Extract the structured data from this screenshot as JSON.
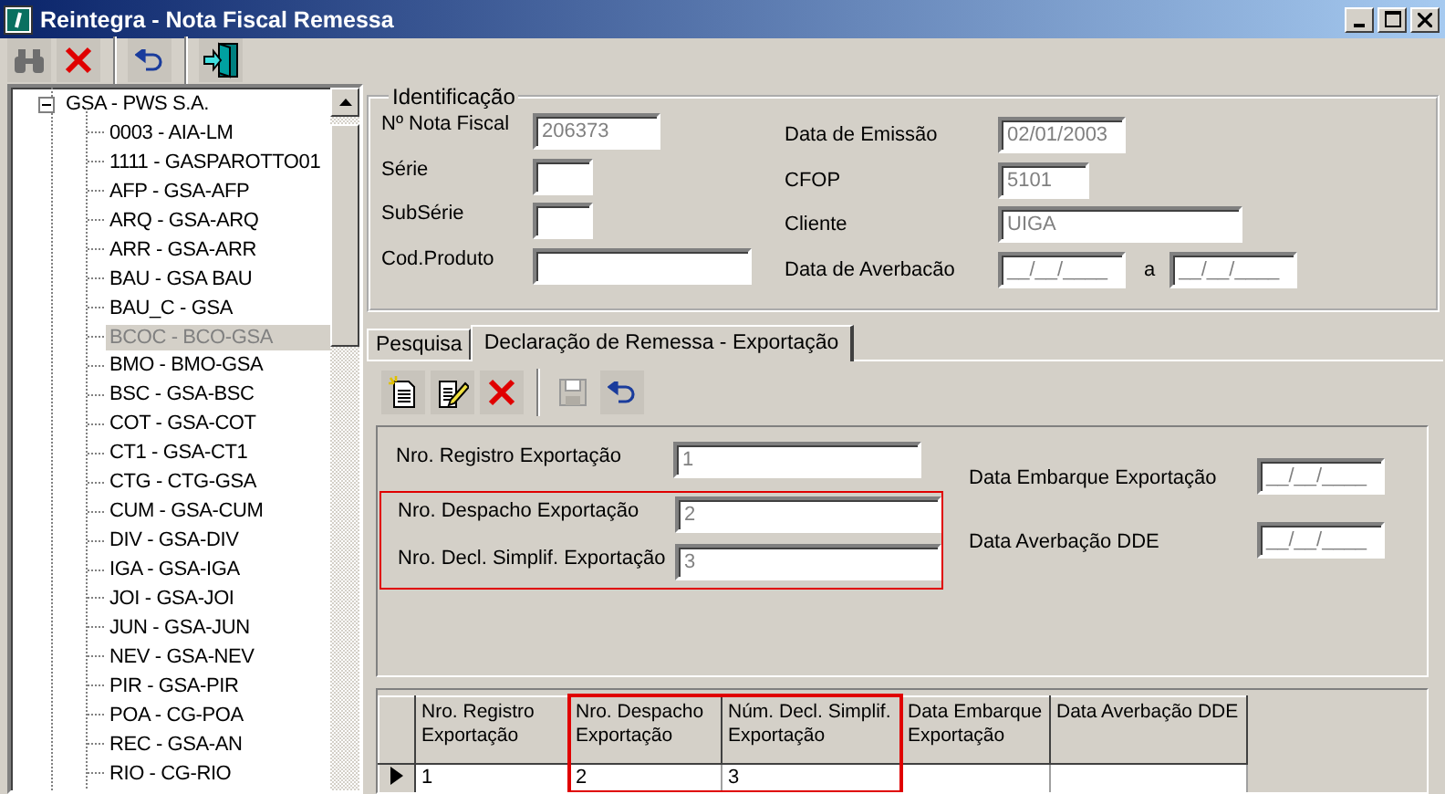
{
  "window": {
    "title": "Reintegra - Nota Fiscal Remessa"
  },
  "toolbar": [
    {
      "kind": "search",
      "disabled": false
    },
    {
      "kind": "delete",
      "disabled": false
    },
    {
      "kind": "undo",
      "disabled": false
    },
    {
      "kind": "exit",
      "disabled": false
    }
  ],
  "tree": {
    "label": "GSA - PWS S.A.",
    "expanded": true,
    "children": [
      {
        "label": "0003 - AIA-LM",
        "selected": false
      },
      {
        "label": "1111 - GASPAROTTO01",
        "selected": false
      },
      {
        "label": "AFP - GSA-AFP",
        "selected": false
      },
      {
        "label": "ARQ - GSA-ARQ",
        "selected": false
      },
      {
        "label": "ARR - GSA-ARR",
        "selected": false
      },
      {
        "label": "BAU - GSA BAU",
        "selected": false
      },
      {
        "label": "BAU_C - GSA",
        "selected": false
      },
      {
        "label": "BCOC - BCO-GSA",
        "selected": true
      },
      {
        "label": "BMO - BMO-GSA",
        "selected": false
      },
      {
        "label": "BSC - GSA-BSC",
        "selected": false
      },
      {
        "label": "COT - GSA-COT",
        "selected": false
      },
      {
        "label": "CT1 - GSA-CT1",
        "selected": false
      },
      {
        "label": "CTG - CTG-GSA",
        "selected": false
      },
      {
        "label": "CUM - GSA-CUM",
        "selected": false
      },
      {
        "label": "DIV - GSA-DIV",
        "selected": false
      },
      {
        "label": "IGA - GSA-IGA",
        "selected": false
      },
      {
        "label": "JOI - GSA-JOI",
        "selected": false
      },
      {
        "label": "JUN - GSA-JUN",
        "selected": false
      },
      {
        "label": "NEV - GSA-NEV",
        "selected": false
      },
      {
        "label": "PIR - GSA-PIR",
        "selected": false
      },
      {
        "label": "POA - CG-POA",
        "selected": false
      },
      {
        "label": "REC - GSA-AN",
        "selected": false
      },
      {
        "label": "RIO - CG-RIO",
        "selected": false
      }
    ]
  },
  "identificacao": {
    "title": "Identificação",
    "left_fields": [
      {
        "label": "Nº Nota Fiscal",
        "kind": "number",
        "value": "206373"
      },
      {
        "label": "Série",
        "kind": "short"
      },
      {
        "label": "SubSérie",
        "kind": "short"
      },
      {
        "label": "Cod.Produto",
        "kind": "long"
      }
    ],
    "right_fields": [
      {
        "label": "Data de Emissão",
        "kind": "date",
        "value": "02/01/2003"
      },
      {
        "label": "CFOP",
        "kind": "code",
        "value": "5101"
      },
      {
        "label": "Cliente",
        "kind": "name",
        "value": "UIGA"
      },
      {
        "label": "Data de Averbacão",
        "kind": "date",
        "value": "__/__/____",
        "separator": "a",
        "value_to": "__/__/____"
      }
    ]
  },
  "tabs": [
    {
      "label": "Pesquisa",
      "selected": false
    },
    {
      "label": "Declaração de Remessa - Exportação",
      "selected": true
    }
  ],
  "tab_toolbar": [
    {
      "kind": "new",
      "disabled": false
    },
    {
      "kind": "edit",
      "disabled": false
    },
    {
      "kind": "delete",
      "disabled": false
    },
    {
      "kind": "save",
      "disabled": true
    },
    {
      "kind": "undo",
      "disabled": false
    }
  ],
  "export_fields": {
    "left": [
      {
        "label": "Nro. Registro Exportação",
        "value": "1",
        "highlighted": false
      },
      {
        "label": "Nro. Despacho Exportação",
        "value": "2",
        "highlighted": true
      },
      {
        "label": "Nro. Decl. Simplif. Exportação",
        "value": "3",
        "highlighted": true
      }
    ],
    "right": [
      {
        "label": "Data Embarque Exportação",
        "value": "__/__/____"
      },
      {
        "label": "Data Averbação DDE",
        "value": "__/__/____"
      }
    ]
  },
  "grid": {
    "columns": [
      {
        "label": "Nro. Registro Exportação",
        "highlighted": false
      },
      {
        "label": "Nro. Despacho Exportação",
        "highlighted": true
      },
      {
        "label": "Núm. Decl. Simplif. Exportação",
        "highlighted": true
      },
      {
        "label": "Data Embarque Exportação",
        "highlighted": false
      },
      {
        "label": "Data Averbação DDE",
        "highlighted": false
      }
    ],
    "rows": [
      {
        "current": true,
        "cells": [
          "1",
          "2",
          "3"
        ]
      }
    ]
  }
}
